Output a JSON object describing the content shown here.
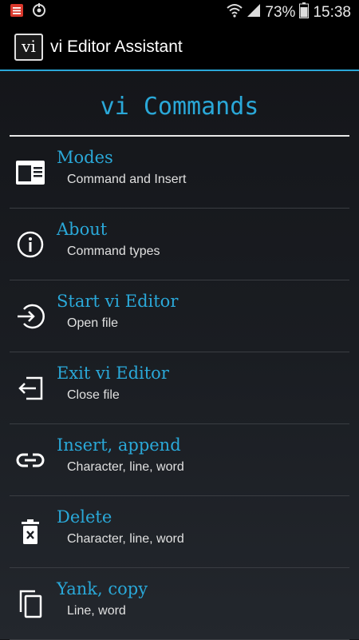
{
  "status_bar": {
    "battery_percent": "73%",
    "time": "15:38"
  },
  "action_bar": {
    "app_icon_text": "vi",
    "title": "vi Editor Assistant"
  },
  "heading": "vi Commands",
  "menu": [
    {
      "title": "Modes",
      "subtitle": "Command and Insert",
      "icon": "window-icon"
    },
    {
      "title": "About",
      "subtitle": "Command types",
      "icon": "info-icon"
    },
    {
      "title": "Start vi Editor",
      "subtitle": "Open file",
      "icon": "login-icon"
    },
    {
      "title": "Exit vi Editor",
      "subtitle": "Close file",
      "icon": "logout-icon"
    },
    {
      "title": "Insert, append",
      "subtitle": "Character, line, word",
      "icon": "link-icon"
    },
    {
      "title": "Delete",
      "subtitle": "Character, line, word",
      "icon": "trash-icon"
    },
    {
      "title": "Yank, copy",
      "subtitle": "Line, word",
      "icon": "copy-icon"
    }
  ],
  "colors": {
    "accent": "#2aa8d8",
    "background": "#1a1d22",
    "text_secondary": "#e0e0e0"
  }
}
